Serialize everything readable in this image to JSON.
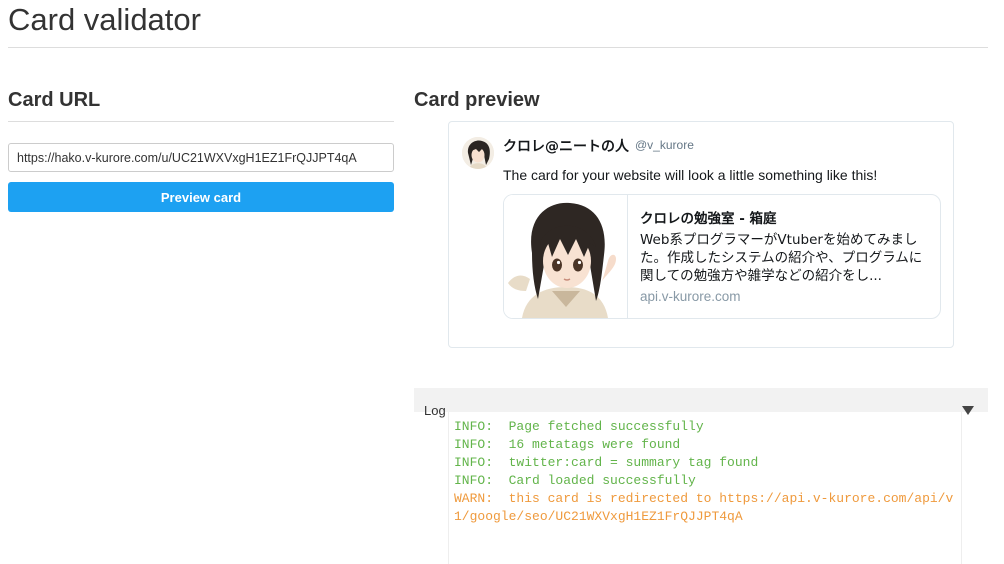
{
  "page": {
    "title": "Card validator"
  },
  "left": {
    "heading": "Card URL",
    "url_value": "https://hako.v-kurore.com/u/UC21WXVxgH1EZ1FrQJJPT4qA",
    "preview_button": "Preview card"
  },
  "right": {
    "heading": "Card preview",
    "tweet": {
      "display_name": "クロレ@ニートの人",
      "handle": "@v_kurore",
      "text": "The card for your website will look a little something like this!",
      "card": {
        "title": "クロレの勉強室 - 箱庭",
        "description": "Web系プログラマーがVtuberを始めてみました。作成したシステムの紹介や、プログラムに関しての勉強方や雑学などの紹介をし...",
        "domain": "api.v-kurore.com"
      }
    }
  },
  "log": {
    "label": "Log",
    "lines": [
      {
        "level": "info",
        "text": "INFO:  Page fetched successfully"
      },
      {
        "level": "info",
        "text": "INFO:  16 metatags were found"
      },
      {
        "level": "info",
        "text": "INFO:  twitter:card = summary tag found"
      },
      {
        "level": "info",
        "text": "INFO:  Card loaded successfully"
      },
      {
        "level": "warn",
        "text": "WARN:  this card is redirected to https://api.v-kurore.com/api/v1/google/seo/UC21WXVxgH1EZ1FrQJJPT4qA"
      }
    ]
  },
  "colors": {
    "accent": "#1da1f2",
    "info": "#62b44a",
    "warn": "#ef9a3d"
  },
  "icons": {
    "log_toggle": "triangle-down-icon"
  }
}
